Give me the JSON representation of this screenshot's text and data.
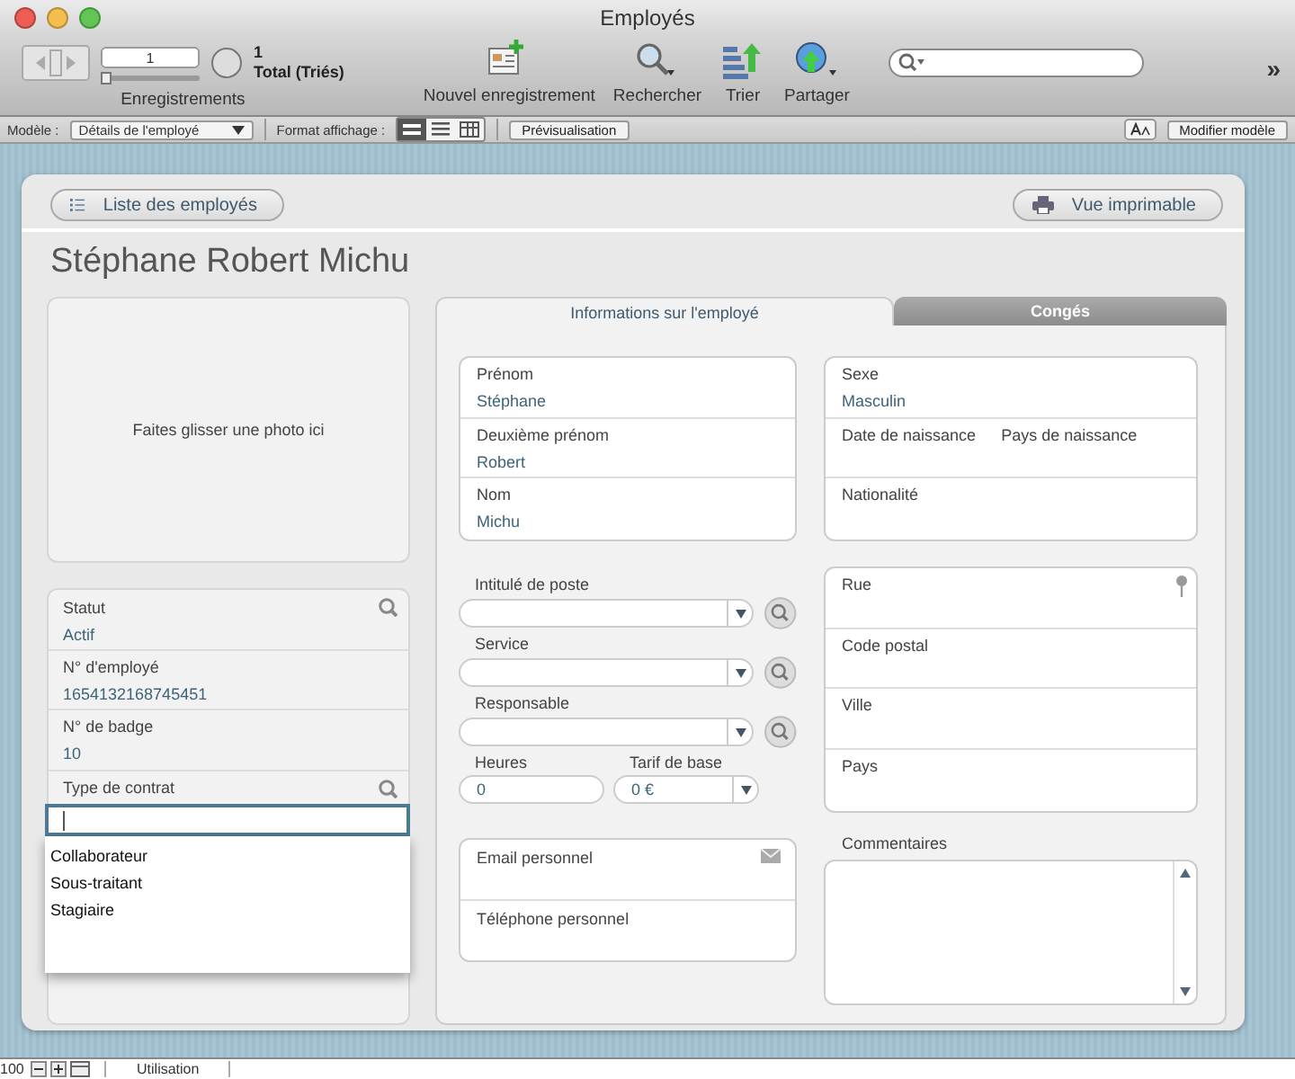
{
  "window": {
    "title": "Employés"
  },
  "toolbar": {
    "record_number": "1",
    "record_count": "1",
    "count_label": "Total (Triés)",
    "records_label": "Enregistrements",
    "slider": {
      "level": 0.0
    },
    "buttons": [
      {
        "label": "Nouvel enregistrement",
        "kind": "new"
      },
      {
        "label": "Rechercher",
        "kind": "find"
      },
      {
        "label": "Trier",
        "kind": "sort"
      },
      {
        "label": "Partager",
        "kind": "share"
      }
    ],
    "overflow": "»"
  },
  "layout_bar": {
    "model_label": "Modèle :",
    "model_value": "Détails de l'employé",
    "format_label": "Format affichage :",
    "view_modes": [
      {
        "kind": "form",
        "selected": true
      },
      {
        "kind": "list",
        "selected": false
      },
      {
        "kind": "table",
        "selected": false
      }
    ],
    "preview_button": "Prévisualisation",
    "edit_button": "Modifier modèle"
  },
  "form": {
    "list_button": "Liste des employés",
    "print_button": "Vue imprimable",
    "name": "Stéphane Robert Michu",
    "photo_hint": "Faites glisser une photo ici",
    "left_fields": [
      {
        "label": "Statut",
        "value": "Actif",
        "search": true
      },
      {
        "label": "N° d'employé",
        "value": "1654132168745451",
        "search": false
      },
      {
        "label": "N° de badge",
        "value": "10",
        "search": false
      },
      {
        "label": "Type de contrat",
        "search": true
      }
    ],
    "contract_options": [
      {
        "label": "Collaborateur"
      },
      {
        "label": "Sous-traitant"
      },
      {
        "label": "Stagiaire"
      }
    ],
    "tabs": [
      {
        "label": "Informations sur l'employé",
        "selected": true
      },
      {
        "label": "Congés",
        "selected": false
      }
    ],
    "identity": [
      {
        "labels": [
          "Prénom"
        ],
        "value": "Stéphane"
      },
      {
        "labels": [
          "Deuxième prénom"
        ],
        "value": "Robert"
      },
      {
        "labels": [
          "Nom"
        ],
        "value": "Michu"
      }
    ],
    "personal": [
      {
        "labels": [
          "Sexe"
        ],
        "value": "Masculin"
      },
      {
        "labels": [
          "Date de naissance",
          "Pays de naissance"
        ]
      },
      {
        "labels": [
          "Nationalité"
        ]
      }
    ],
    "job_fields": [
      {
        "label": "Intitulé de poste"
      },
      {
        "label": "Service"
      },
      {
        "label": "Responsable"
      }
    ],
    "heures": {
      "label": "Heures",
      "value": "0"
    },
    "tarif": {
      "label": "Tarif de base",
      "value": "0 €"
    },
    "contact": [
      {
        "label": "Email personnel",
        "kind": "email"
      },
      {
        "label": "Téléphone personnel",
        "kind": "plain"
      }
    ],
    "address": [
      {
        "label": "Rue",
        "kind": "pin"
      },
      {
        "label": "Code postal",
        "kind": "plain"
      },
      {
        "label": "Ville",
        "kind": "plain"
      },
      {
        "label": "Pays",
        "kind": "plain"
      }
    ],
    "comments_label": "Commentaires"
  },
  "status_bar": {
    "zoom": "100",
    "mode": "Utilisation"
  }
}
